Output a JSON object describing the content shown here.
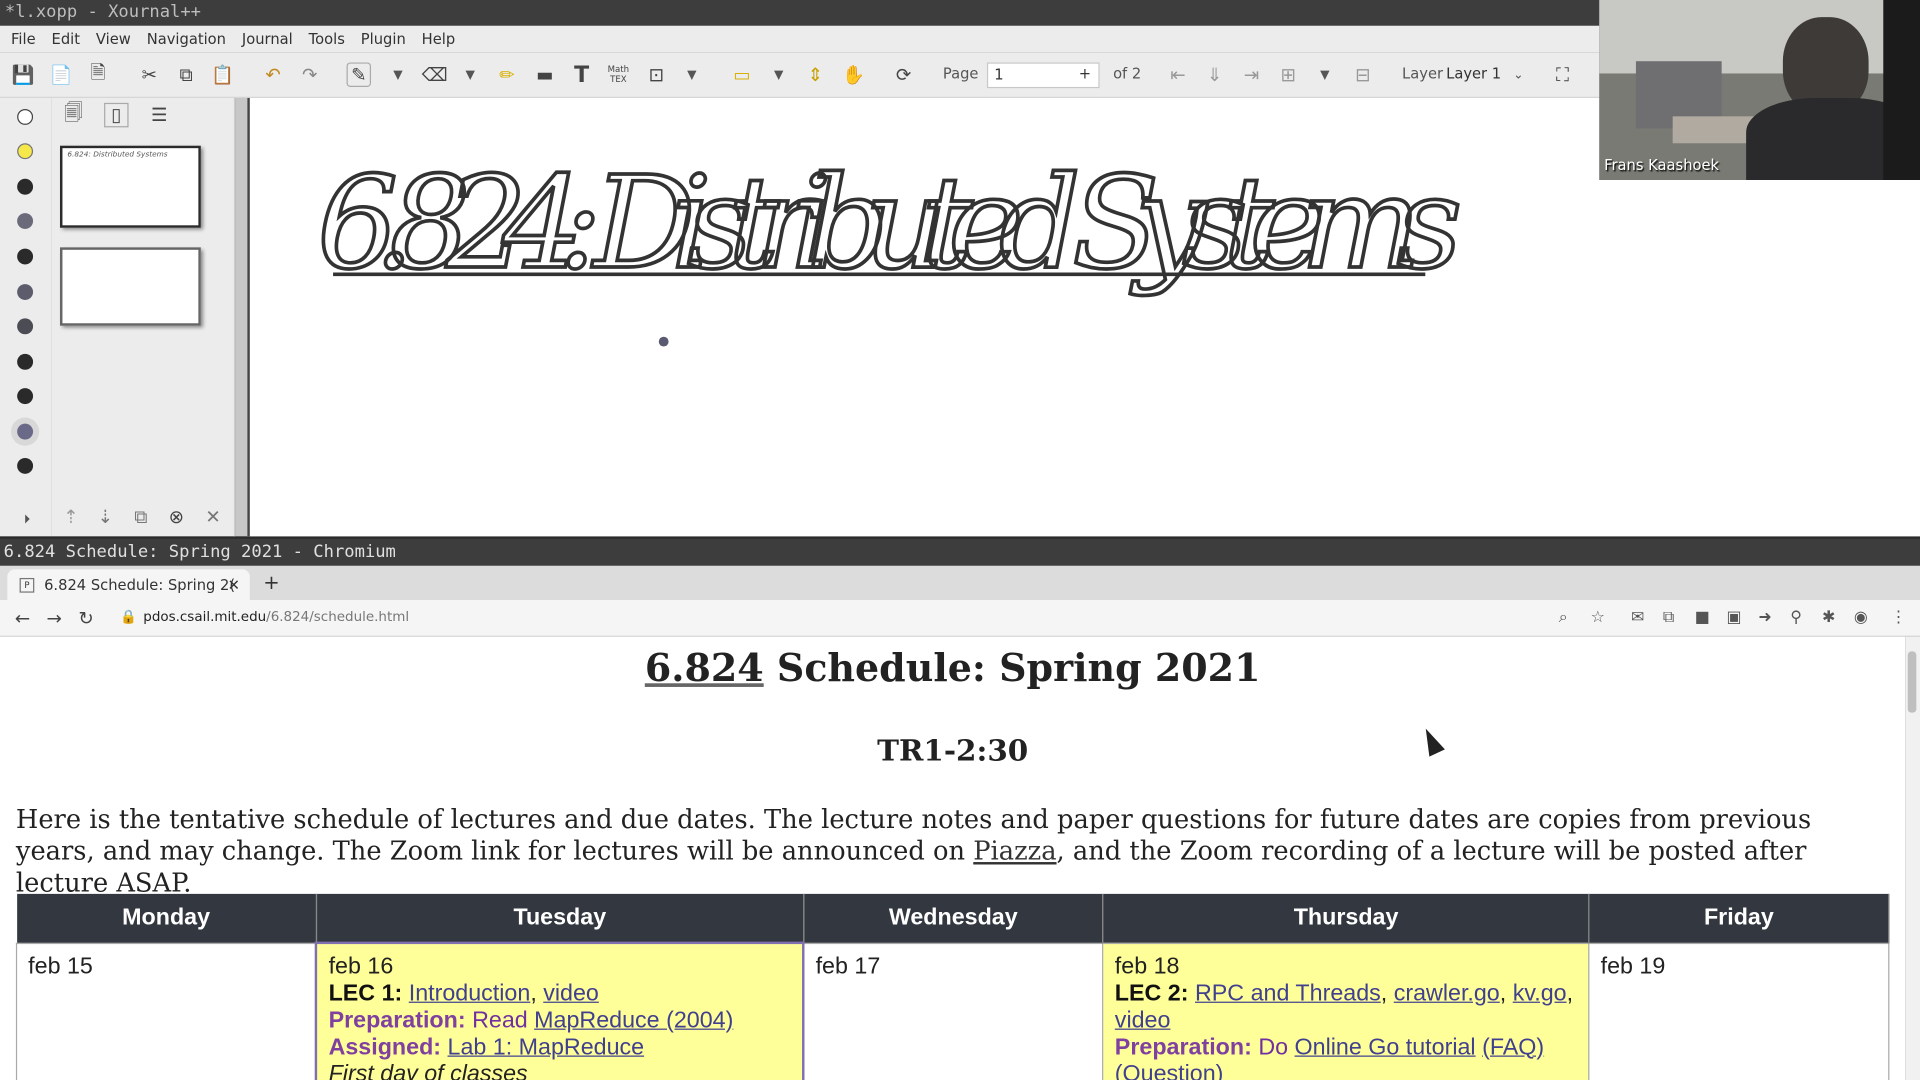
{
  "xournal": {
    "window_title": "*l.xopp - Xournal++",
    "menu": [
      "File",
      "Edit",
      "View",
      "Navigation",
      "Journal",
      "Tools",
      "Plugin",
      "Help"
    ],
    "page_label": "Page",
    "page_value": "1",
    "page_total": "of 2",
    "layer_label": "Layer",
    "layer_value": "Layer 1",
    "math_tex": "Math TEX",
    "thumb1_text": "6.824: Distributed Systems",
    "handwriting": "6.824:  Distributed  Systems"
  },
  "webcam": {
    "name": "Frans Kaashoek"
  },
  "chromium": {
    "window_title": "6.824 Schedule: Spring 2021 - Chromium",
    "tab_title": "6.824 Schedule: Spring 2(",
    "url_host": "pdos.csail.mit.edu",
    "url_path": "/6.824/schedule.html"
  },
  "page": {
    "title_link": "6.824",
    "title_rest": " Schedule: Spring 2021",
    "subtitle": "TR1-2:30",
    "intro_1": "Here is the tentative schedule of lectures and due dates. The lecture notes and paper questions for future dates are copies from previous years, and may change. The Zoom link for lectures will be announced on ",
    "intro_link": "Piazza",
    "intro_2": ", and the Zoom recording of a lecture will be posted after lecture ASAP.",
    "days": [
      "Monday",
      "Tuesday",
      "Wednesday",
      "Thursday",
      "Friday"
    ],
    "mon_date": "feb 15",
    "tue_date": "feb 16",
    "tue_lec_label": "LEC 1:",
    "tue_lec_link1": "Introduction",
    "tue_lec_link2": "video",
    "tue_prep_label": "Preparation:",
    "tue_prep_text": "Read ",
    "tue_prep_link": "MapReduce (2004)",
    "tue_assigned_label": "Assigned:",
    "tue_assigned_link": "Lab 1: MapReduce",
    "tue_note": "First day of classes",
    "wed_date": "feb 17",
    "thu_date": "feb 18",
    "thu_lec_label": "LEC 2:",
    "thu_lec_link1": "RPC and Threads",
    "thu_lec_link2": "crawler.go",
    "thu_lec_link3": "kv.go",
    "thu_lec_link4": "video",
    "thu_prep_label": "Preparation:",
    "thu_prep_text": "Do ",
    "thu_prep_link": "Online Go tutorial",
    "thu_prep_faq": "(FAQ)",
    "thu_prep_question": "(Question)",
    "fri_date": "feb 19"
  },
  "colors": {
    "table_header": "#333840",
    "highlight": "#ffff99",
    "link": "#40408f"
  }
}
